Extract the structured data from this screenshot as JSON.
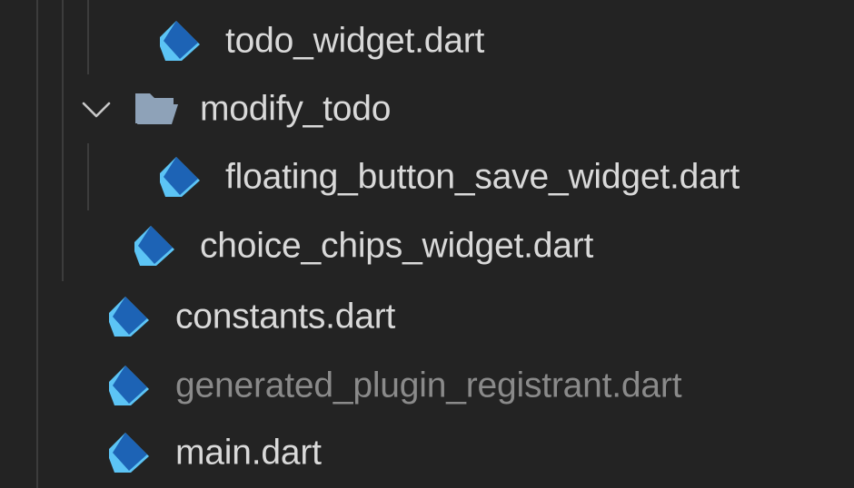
{
  "explorer": {
    "items": [
      {
        "label": "todo_widget.dart",
        "kind": "file",
        "icon": "dart-file-icon",
        "depth": 3
      },
      {
        "label": "modify_todo",
        "kind": "folder",
        "icon": "folder-open-icon",
        "expanded": true,
        "depth": 2
      },
      {
        "label": "floating_button_save_widget.dart",
        "kind": "file",
        "icon": "dart-file-icon",
        "depth": 3
      },
      {
        "label": "choice_chips_widget.dart",
        "kind": "file",
        "icon": "dart-file-icon",
        "depth": 2
      },
      {
        "label": "constants.dart",
        "kind": "file",
        "icon": "dart-file-icon",
        "depth": 1
      },
      {
        "label": "generated_plugin_registrant.dart",
        "kind": "file",
        "icon": "dart-file-icon",
        "depth": 1,
        "dimmed": true
      },
      {
        "label": "main.dart",
        "kind": "file",
        "icon": "dart-file-icon",
        "depth": 1
      }
    ]
  },
  "colors": {
    "background": "#232323",
    "text": "#d9d9d9",
    "text_dimmed": "#8a8a8a",
    "dart_light": "#5cc4f5",
    "dart_dark": "#1d63b5",
    "folder": "#8ea2b8"
  }
}
